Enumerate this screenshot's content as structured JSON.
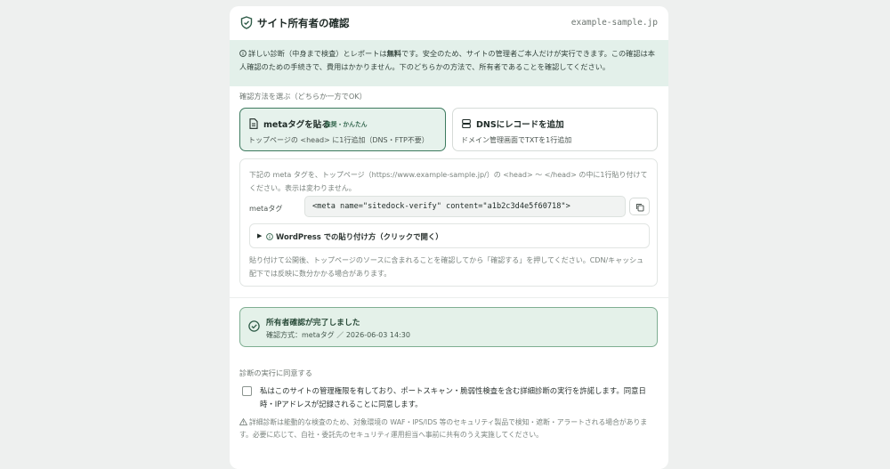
{
  "header": {
    "title": "サイト所有者の確認",
    "domain": "example-sample.jp"
  },
  "info": {
    "part1": "詳しい診断（中身まで検査）とレポートは",
    "bold": "無料",
    "part2": "です。安全のため、サイトの管理者ご本人だけが実行できます。この確認は本人確認のための手続きで、費用はかかりません。下のどちらかの方法で、所有者であることを確認してください。"
  },
  "method": {
    "label": "確認方法を選ぶ（どちらか一方でOK）",
    "options": [
      {
        "title": "metaタグを貼る",
        "badge": "推奨・かんたん",
        "desc": "トップページの <head> に1行追加（DNS・FTP不要）",
        "selected": true
      },
      {
        "title": "DNSにレコードを追加",
        "badge": "",
        "desc": "ドメイン管理画面でTXTを1行追加",
        "selected": false
      }
    ]
  },
  "meta_panel": {
    "desc": "下記の meta タグを、トップページ（https://www.example-sample.jp/）の <head> 〜 </head> の中に1行貼り付けてください。表示は変わりません。",
    "label": "metaタグ",
    "code": "<meta name=\"sitedock-verify\" content=\"a1b2c3d4e5f60718\">",
    "accordion": "WordPress での貼り付け方（クリックで開く）",
    "note": "貼り付けて公開後、トップページのソースに含まれることを確認してから「確認する」を押してください。CDN/キャッシュ配下では反映に数分かかる場合があります。"
  },
  "status": {
    "title": "所有者確認が完了しました",
    "detail": "確認方式：metaタグ ／ 2026-06-03 14:30"
  },
  "consent": {
    "label": "診断の実行に同意する",
    "text": "私はこのサイトの管理権限を有しており、ポートスキャン・脆弱性検査を含む詳細診断の実行を許諾します。同意日時・IPアドレスが記録されることに同意します。",
    "checked": false,
    "warning": "詳細診断は能動的な検査のため、対象環境の WAF・IPS/IDS 等のセキュリティ製品で検知・遮断・アラートされる場合があります。必要に応じて、自社・委託先のセキュリティ運用担当へ事前に共有のうえ実施してください。"
  },
  "colors": {
    "accent": "#3d7a5f",
    "info_bg": "#e3f0ea",
    "success_bg": "#e4f1e9"
  }
}
